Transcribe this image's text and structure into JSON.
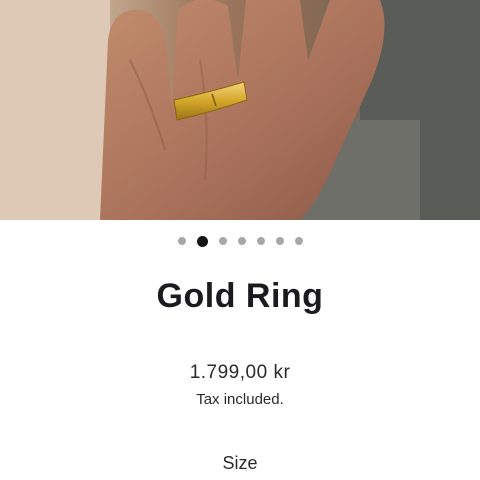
{
  "product": {
    "title": "Gold Ring",
    "price": "1.799,00 kr",
    "tax_note": "Tax included.",
    "size_label": "Size"
  },
  "gallery": {
    "slide_count": 7,
    "active_index": 1
  },
  "colors": {
    "text": "#1b1b1f",
    "dot_active": "#151515",
    "dot_inactive": "#a8a8a8",
    "ring_gold": "#d4a62a"
  }
}
